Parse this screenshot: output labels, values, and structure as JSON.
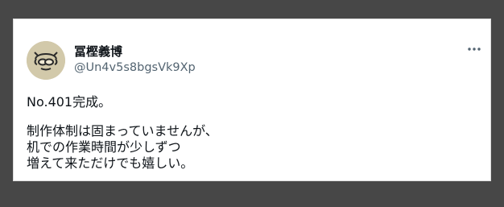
{
  "post": {
    "author_name": "冨樫義博",
    "author_handle": "@Un4v5s8bgsVk9Xp",
    "text_lines": [
      "No.401完成。",
      "制作体制は固まっていませんが、",
      "机での作業時間が少しずつ",
      "増えて来ただけでも嬉しい。"
    ],
    "more_icon": "more-horizontal-icon",
    "avatar_icon": "avatar-sketch-icon"
  },
  "colors": {
    "background": "#474747",
    "card": "#ffffff",
    "text_primary": "#0f1419",
    "text_secondary": "#536471"
  }
}
